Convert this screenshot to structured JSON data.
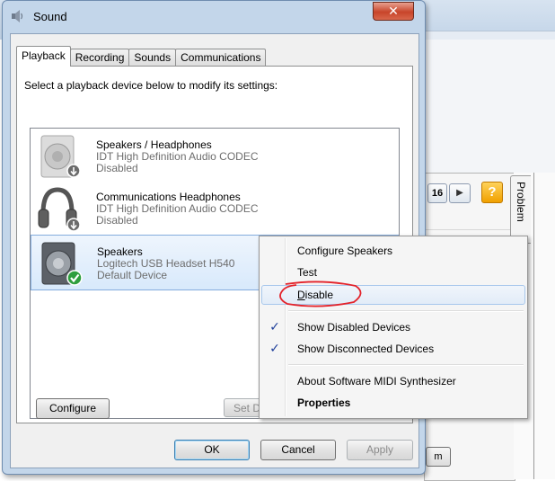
{
  "window": {
    "title": "Sound",
    "close_glyph": "✕"
  },
  "tabs": [
    {
      "label": "Playback",
      "active": true
    },
    {
      "label": "Recording",
      "active": false
    },
    {
      "label": "Sounds",
      "active": false
    },
    {
      "label": "Communications",
      "active": false
    }
  ],
  "instruction": "Select a playback device below to modify its settings:",
  "devices": [
    {
      "name": "Speakers / Headphones",
      "driver": "IDT High Definition Audio CODEC",
      "state": "Disabled",
      "icon": "speaker-icon",
      "badge": "disabled-arrow-icon"
    },
    {
      "name": "Communications Headphones",
      "driver": "IDT High Definition Audio CODEC",
      "state": "Disabled",
      "icon": "headphones-icon",
      "badge": "disabled-arrow-icon"
    },
    {
      "name": "Speakers",
      "driver": "Logitech USB Headset H540",
      "state": "Default Device",
      "icon": "speaker-icon",
      "badge": "default-check-icon",
      "selected": true
    }
  ],
  "buttons": {
    "configure": "Configure",
    "set_default_visible": "Set D",
    "ok": "OK",
    "cancel": "Cancel",
    "apply": "Apply"
  },
  "context_menu": {
    "items": [
      {
        "label": "Configure Speakers"
      },
      {
        "label": "Test"
      },
      {
        "label": "Disable",
        "accel": "D",
        "hovered": true
      },
      {
        "label": "Show Disabled Devices",
        "checked": true
      },
      {
        "label": "Show Disconnected Devices",
        "checked": true
      },
      {
        "label": "About Software MIDI Synthesizer"
      },
      {
        "label": "Properties",
        "bold": true
      }
    ],
    "check_glyph": "✓"
  },
  "background_app": {
    "pager_page": "16",
    "pager_next_glyph": "▶",
    "help_glyph": "?",
    "side_tab": "Problem",
    "button_fragment": "m"
  },
  "colors": {
    "annotation_red": "#e3232b",
    "selection_border": "#84acdd",
    "dialog_frame": "#c3d6ea"
  }
}
